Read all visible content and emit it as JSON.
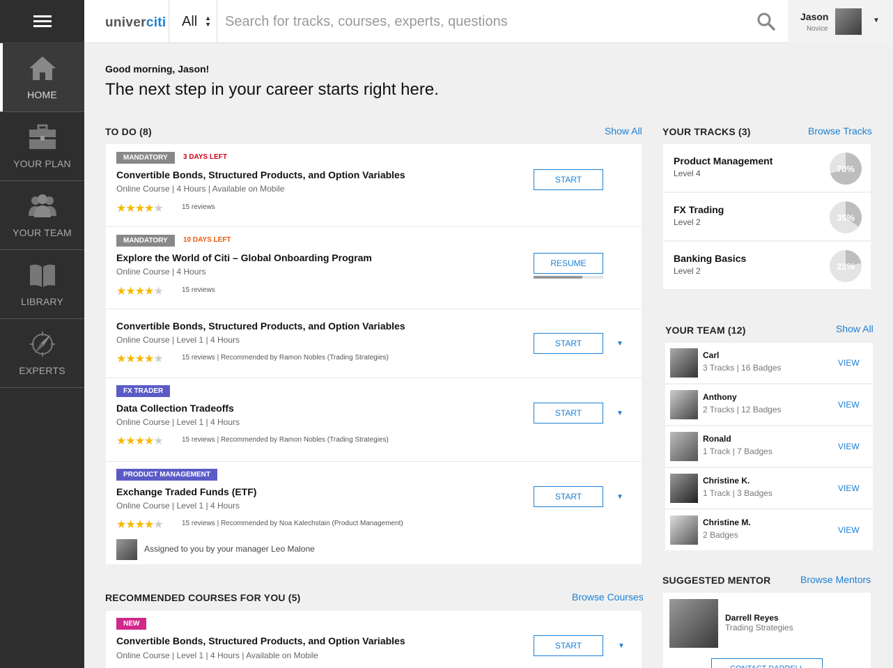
{
  "sidebar": {
    "items": [
      {
        "label": "HOME",
        "icon": "home-icon"
      },
      {
        "label": "YOUR PLAN",
        "icon": "briefcase-icon"
      },
      {
        "label": "YOUR TEAM",
        "icon": "team-icon"
      },
      {
        "label": "LIBRARY",
        "icon": "book-icon"
      },
      {
        "label": "EXPERTS",
        "icon": "compass-icon"
      }
    ]
  },
  "header": {
    "logo_text_1": "univer",
    "logo_text_2": "citi",
    "scope": "All",
    "search_placeholder": "Search for tracks, courses, experts, questions",
    "user_name": "Jason",
    "user_level": "Novice"
  },
  "greeting": {
    "small": "Good morning, Jason!",
    "big": "The next step in your career starts right here."
  },
  "todo": {
    "title": "TO DO (8)",
    "link": "Show All",
    "items": [
      {
        "tag": "MANDATORY",
        "deadline": "3 DAYS LEFT",
        "title": "Convertible Bonds, Structured Products, and Option Variables",
        "meta": "Online Course  |  4 Hours  |  Available on Mobile",
        "rating": 4,
        "reviews": "15 reviews",
        "button": "START"
      },
      {
        "tag": "MANDATORY",
        "deadline": "10 DAYS LEFT",
        "title": "Explore the World of Citi – Global Onboarding Program",
        "meta": "Online Course  |  4 Hours",
        "rating": 4,
        "reviews": "15 reviews",
        "button": "RESUME",
        "progress": 0.7
      },
      {
        "title": "Convertible Bonds, Structured Products, and Option Variables",
        "meta": "Online Course  |  Level 1  |  4 Hours",
        "rating": 4,
        "reviews": "15 reviews  |  Recommended by Ramon Nobles (Trading Strategies)",
        "button": "START"
      },
      {
        "tag": "FX TRADER",
        "title": "Data Collection Tradeoffs",
        "meta": "Online Course  |  Level 1  |  4 Hours",
        "rating": 4,
        "reviews": "15 reviews  |  Recommended by Ramon Nobles (Trading Strategies)",
        "button": "START"
      },
      {
        "tag": "PRODUCT MANAGEMENT",
        "title": "Exchange Traded Funds (ETF)",
        "meta": "Online Course  |  Level 1  |  4 Hours",
        "rating": 4,
        "reviews": "15 reviews  |  Recommended by Noa Kalechstain (Product Management)",
        "button": "START",
        "assigned": "Assigned to you by your manager Leo Malone"
      }
    ]
  },
  "recommended": {
    "title": "RECOMMENDED COURSES FOR YOU (5)",
    "link": "Browse Courses",
    "items": [
      {
        "tag": "NEW",
        "title": "Convertible Bonds, Structured Products, and Option Variables",
        "meta": "Online Course  |  Level 1  |  4 Hours  |  Available on Mobile",
        "button": "START"
      }
    ]
  },
  "tracks": {
    "title": "YOUR TRACKS (3)",
    "link": "Browse Tracks",
    "items": [
      {
        "name": "Product Management",
        "level": "Level 4",
        "percent": "70%",
        "value": 0.7
      },
      {
        "name": "FX Trading",
        "level": "Level 2",
        "percent": "35%",
        "value": 0.35
      },
      {
        "name": "Banking Basics",
        "level": "Level 2",
        "percent": "22%",
        "value": 0.22
      }
    ]
  },
  "team": {
    "title": "YOUR TEAM (12)",
    "link": "Show All",
    "members": [
      {
        "name": "Carl",
        "meta": "3 Tracks  |  16 Badges",
        "view": "VIEW"
      },
      {
        "name": "Anthony",
        "meta": "2 Tracks  |  12 Badges",
        "view": "VIEW"
      },
      {
        "name": "Ronald",
        "meta": "1 Track  |  7 Badges",
        "view": "VIEW"
      },
      {
        "name": "Christine K.",
        "meta": "1 Track  |  3 Badges",
        "view": "VIEW"
      },
      {
        "name": "Christine M.",
        "meta": "2 Badges",
        "view": "VIEW"
      }
    ]
  },
  "mentor": {
    "title": "SUGGESTED MENTOR",
    "link": "Browse Mentors",
    "name": "Darrell Reyes",
    "role": "Trading Strategies",
    "button": "CONTACT DARRELL"
  },
  "colors": {
    "accent": "#1a7fd4",
    "sidebar": "#2e2e2e",
    "tag_gray": "#888888",
    "tag_purple": "#5b5bc7",
    "tag_new": "#d1288a",
    "deadline_red": "#d0021b",
    "deadline_orange": "#e8590c",
    "star": "#f5b800"
  }
}
